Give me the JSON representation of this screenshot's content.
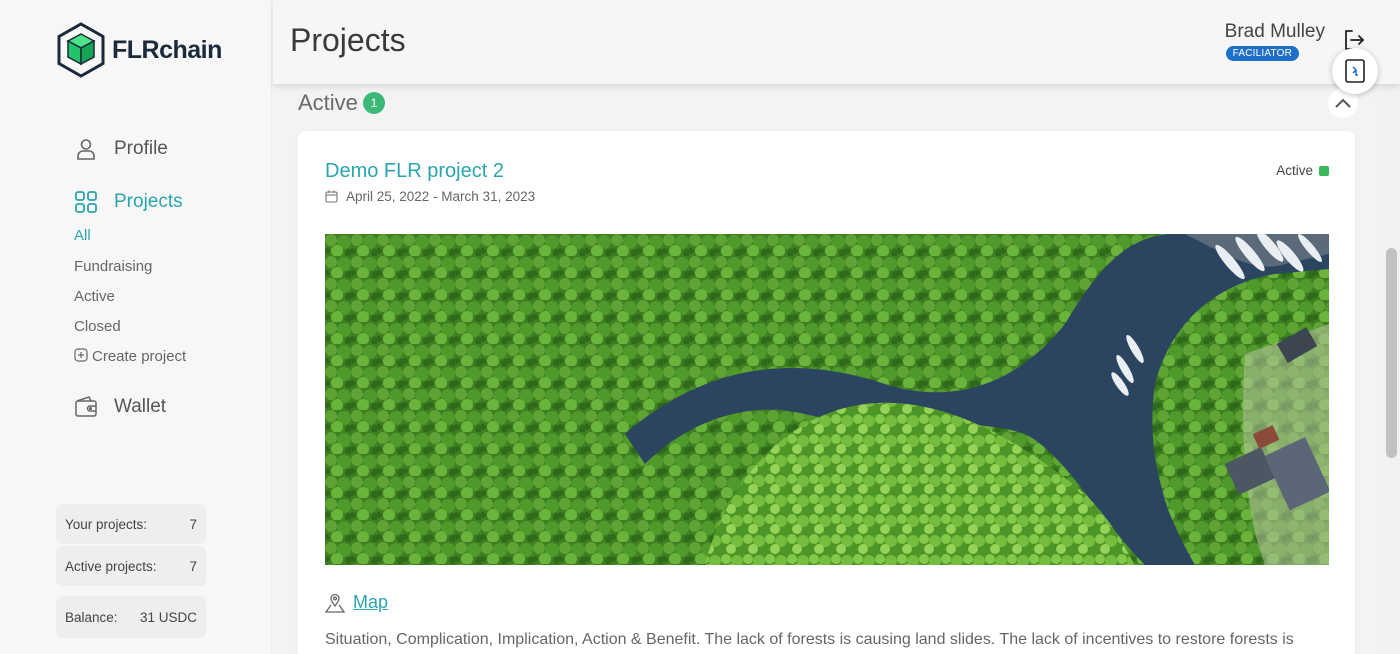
{
  "brand": {
    "name": "FLRchain"
  },
  "sidebar": {
    "profile_label": "Profile",
    "projects_label": "Projects",
    "sub_items": [
      {
        "label": "All",
        "active": true
      },
      {
        "label": "Fundraising",
        "active": false
      },
      {
        "label": "Active",
        "active": false
      },
      {
        "label": "Closed",
        "active": false
      }
    ],
    "create_project_label": "Create project",
    "wallet_label": "Wallet",
    "stats": {
      "your_projects_label": "Your projects:",
      "your_projects_value": "7",
      "active_projects_label": "Active projects:",
      "active_projects_value": "7",
      "balance_label": "Balance:",
      "balance_value": "31 USDC"
    }
  },
  "header": {
    "title": "Projects",
    "user_name": "Brad Mulley",
    "user_role": "FACILIATOR"
  },
  "section": {
    "title": "Active",
    "count": "1"
  },
  "project": {
    "title": "Demo FLR project 2",
    "dates": "April 25, 2022 - March 31, 2023",
    "status": "Active",
    "map_label": "Map",
    "description": "Situation, Complication, Implication, Action & Benefit. The lack of forests is causing land slides. The lack of incentives to restore forests is"
  },
  "colors": {
    "accent": "#2ba5ad",
    "status_green": "#3cb85c",
    "badge_blue": "#1f6fc9"
  }
}
